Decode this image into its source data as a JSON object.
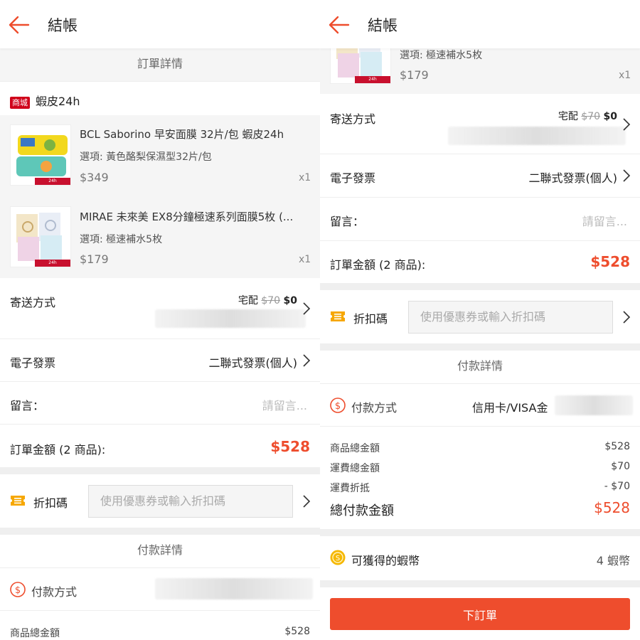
{
  "header": {
    "title": "結帳"
  },
  "order": {
    "section_title": "訂單詳情",
    "shop_badge": "商城",
    "shop_name": "蝦皮24h",
    "products": [
      {
        "name": "BCL Saborino 早安面膜 32片/包 蝦皮24h",
        "option": "選項: 黃色酪梨保濕型32片/包",
        "price": "$349",
        "qty": "x1"
      },
      {
        "name": "MIRAE 未來美 EX8分鐘極速系列面膜5枚 (...",
        "option": "選項: 極速補水5枚",
        "price": "$179",
        "qty": "x1"
      }
    ],
    "shipping": {
      "label": "寄送方式",
      "method": "宅配",
      "original_fee": "$70",
      "fee": "$0"
    },
    "invoice": {
      "label": "電子發票",
      "value": "二聯式發票(個人)"
    },
    "message": {
      "label": "留言：",
      "placeholder": "請留言..."
    },
    "total": {
      "label": "訂單金額 (2 商品):",
      "value": "$528"
    }
  },
  "coupon": {
    "label": "折扣碼",
    "placeholder": "使用優惠券或輸入折扣碼"
  },
  "payment": {
    "section_title": "付款詳情",
    "method_label": "付款方式",
    "method_value": "信用卡/VISA金",
    "rows": [
      {
        "label": "商品總金額",
        "value": "$528"
      },
      {
        "label": "運費總金額",
        "value": "$70"
      },
      {
        "label": "運費折抵",
        "value": "- $70"
      }
    ],
    "grand_total": {
      "label": "總付款金額",
      "value": "$528"
    }
  },
  "coins": {
    "label": "可獲得的蝦幣",
    "value": "4 蝦幣"
  },
  "submit": {
    "label": "下訂單"
  },
  "colors": {
    "brand": "#ee4d2d",
    "badge": "#d0011b",
    "coupon_icon": "#f6a700",
    "coin": "#f5b700"
  }
}
